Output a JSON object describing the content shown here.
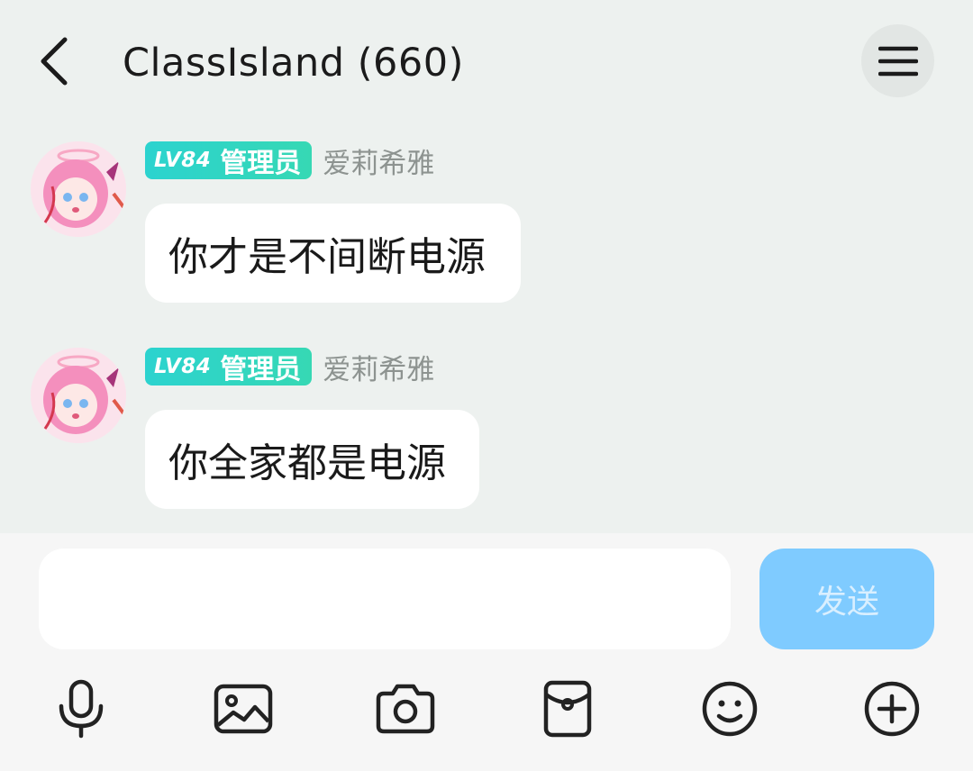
{
  "header": {
    "title": "ClassIsland (660)",
    "back_icon": "chevron-left-icon",
    "menu_icon": "hamburger-menu-icon"
  },
  "messages": [
    {
      "badge_level": "LV84",
      "badge_role": "管理员",
      "sender": "爱莉希雅",
      "text": "你才是不间断电源"
    },
    {
      "badge_level": "LV84",
      "badge_role": "管理员",
      "sender": "爱莉希雅",
      "text": "你全家都是电源"
    }
  ],
  "composer": {
    "input_value": "",
    "send_label": "发送"
  },
  "toolbar": {
    "icons": [
      "microphone-icon",
      "image-icon",
      "camera-icon",
      "red-packet-icon",
      "emoji-icon",
      "plus-icon"
    ]
  },
  "colors": {
    "background": "#edf1ef",
    "badge": "#2cd3cf",
    "send_button": "#7fcbff",
    "bubble": "#ffffff"
  }
}
